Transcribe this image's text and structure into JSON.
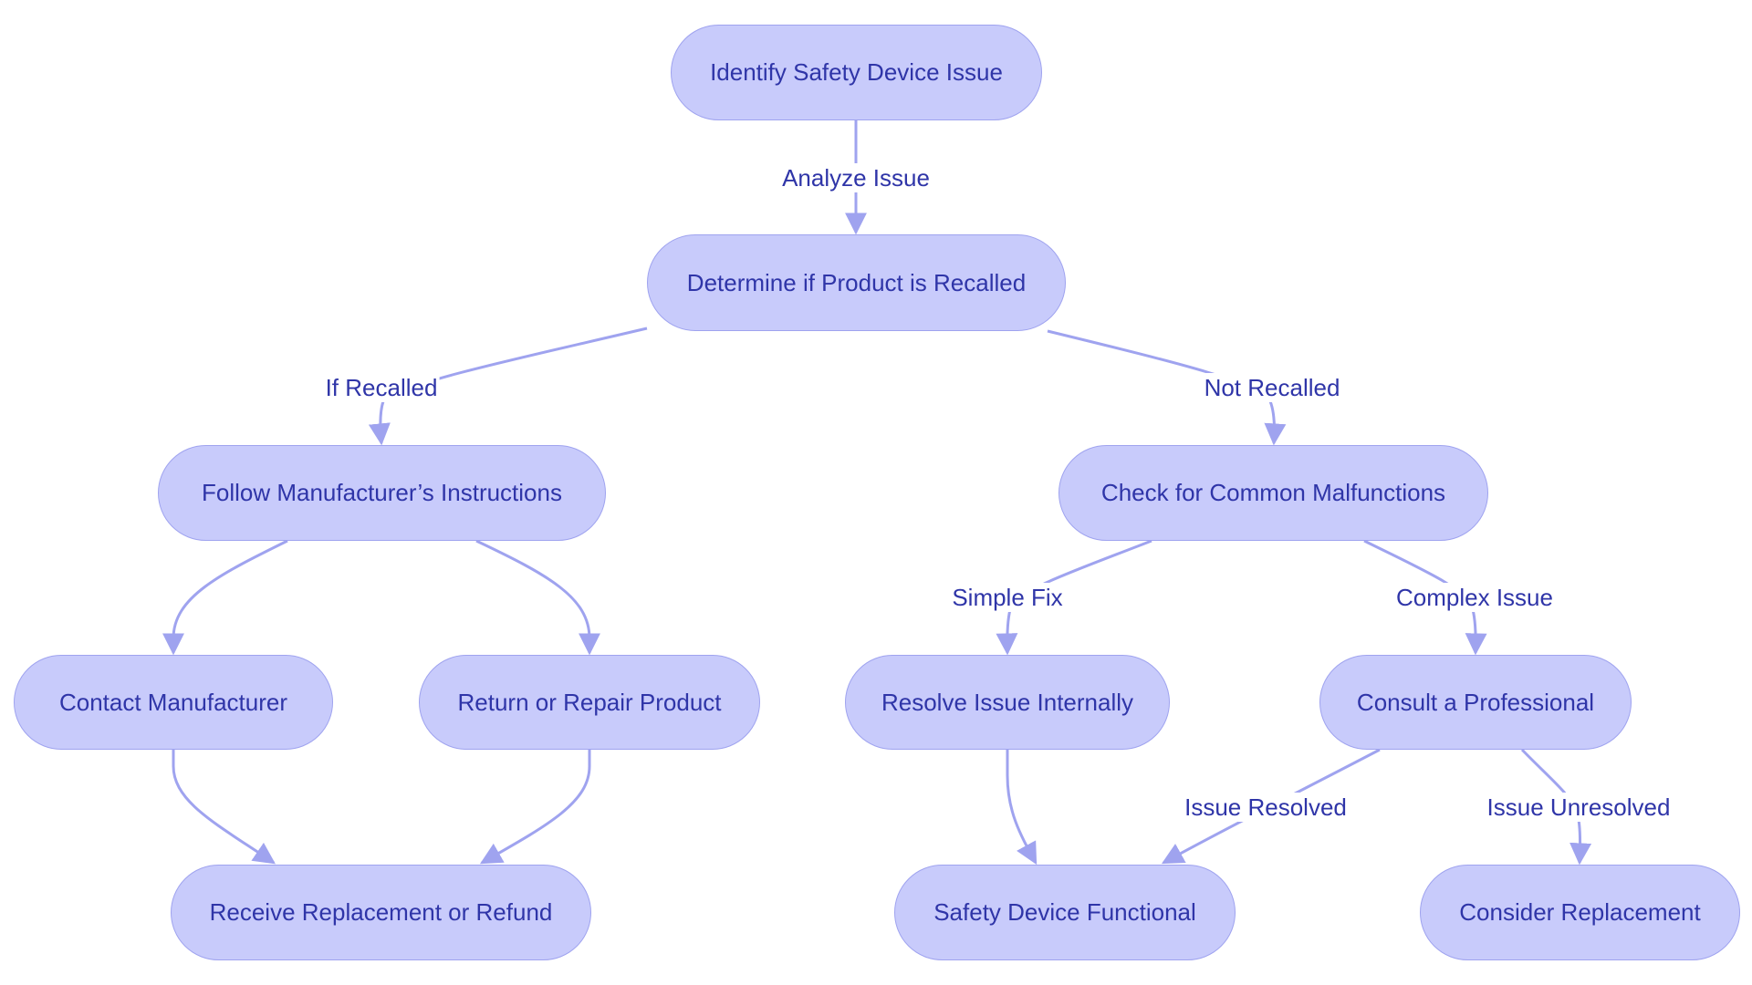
{
  "diagram": {
    "type": "flowchart",
    "colors": {
      "node_fill": "#c8cbfb",
      "node_stroke": "#9fa3ef",
      "edge": "#9fa3ef",
      "text": "#2f35a8"
    },
    "nodes": [
      {
        "id": "identify",
        "label": "Identify Safety Device Issue"
      },
      {
        "id": "determine",
        "label": "Determine if Product is Recalled"
      },
      {
        "id": "follow",
        "label": "Follow Manufacturer’s Instructions"
      },
      {
        "id": "check",
        "label": "Check for Common Malfunctions"
      },
      {
        "id": "contact",
        "label": "Contact Manufacturer"
      },
      {
        "id": "return",
        "label": "Return or Repair Product"
      },
      {
        "id": "resolve",
        "label": "Resolve Issue Internally"
      },
      {
        "id": "consult",
        "label": "Consult a Professional"
      },
      {
        "id": "receive",
        "label": "Receive Replacement or Refund"
      },
      {
        "id": "functional",
        "label": "Safety Device Functional"
      },
      {
        "id": "replace",
        "label": "Consider Replacement"
      }
    ],
    "edges": [
      {
        "from": "identify",
        "to": "determine",
        "label": "Analyze Issue"
      },
      {
        "from": "determine",
        "to": "follow",
        "label": "If Recalled"
      },
      {
        "from": "determine",
        "to": "check",
        "label": "Not Recalled"
      },
      {
        "from": "follow",
        "to": "contact",
        "label": ""
      },
      {
        "from": "follow",
        "to": "return",
        "label": ""
      },
      {
        "from": "check",
        "to": "resolve",
        "label": "Simple Fix"
      },
      {
        "from": "check",
        "to": "consult",
        "label": "Complex Issue"
      },
      {
        "from": "contact",
        "to": "receive",
        "label": ""
      },
      {
        "from": "return",
        "to": "receive",
        "label": ""
      },
      {
        "from": "resolve",
        "to": "functional",
        "label": ""
      },
      {
        "from": "consult",
        "to": "functional",
        "label": "Issue Resolved"
      },
      {
        "from": "consult",
        "to": "replace",
        "label": "Issue Unresolved"
      }
    ]
  }
}
